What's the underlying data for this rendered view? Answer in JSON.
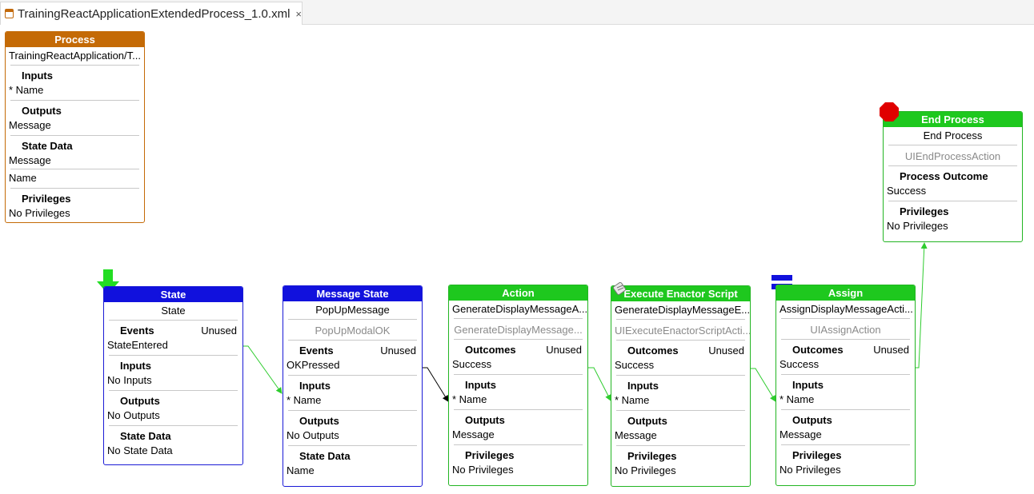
{
  "tab": {
    "title": "TrainingReactApplicationExtendedProcess_1.0.xml",
    "close_glyph": "×",
    "icon": "process-file-icon"
  },
  "colors": {
    "process": "#c46a06",
    "state": "#1111dd",
    "action": "#1ec81e",
    "wire_green": "#2ecc2e",
    "wire_black": "#000000",
    "end_marker": "#e00000"
  },
  "process_node": {
    "header": "Process",
    "name": "TrainingReactApplication/T...",
    "inputs_label": "Inputs",
    "inputs_value": "* Name",
    "outputs_label": "Outputs",
    "outputs_value": "Message",
    "state_data_label": "State Data",
    "state_data_values": [
      "Message",
      "Name"
    ],
    "privileges_label": "Privileges",
    "privileges_value": "No Privileges"
  },
  "state_node": {
    "header": "State",
    "name": "State",
    "events_label": "Events",
    "events_status": "Unused",
    "events_value": "StateEntered",
    "inputs_label": "Inputs",
    "inputs_value": "No Inputs",
    "outputs_label": "Outputs",
    "outputs_value": "No Outputs",
    "state_data_label": "State Data",
    "state_data_value": "No State Data"
  },
  "message_state_node": {
    "header": "Message State",
    "name": "PopUpMessage",
    "subtype": "PopUpModalOK",
    "events_label": "Events",
    "events_status": "Unused",
    "events_value": "OKPressed",
    "inputs_label": "Inputs",
    "inputs_value": "* Name",
    "outputs_label": "Outputs",
    "outputs_value": "No Outputs",
    "state_data_label": "State Data",
    "state_data_value": "Name"
  },
  "action_node": {
    "header": "Action",
    "name": "GenerateDisplayMessageA...",
    "subtype": "GenerateDisplayMessage...",
    "outcomes_label": "Outcomes",
    "outcomes_status": "Unused",
    "outcomes_value": "Success",
    "inputs_label": "Inputs",
    "inputs_value": "* Name",
    "outputs_label": "Outputs",
    "outputs_value": "Message",
    "privileges_label": "Privileges",
    "privileges_value": "No Privileges"
  },
  "script_node": {
    "header": "Execute Enactor Script",
    "name": "GenerateDisplayMessageE...",
    "subtype": "UIExecuteEnactorScriptActi...",
    "outcomes_label": "Outcomes",
    "outcomes_status": "Unused",
    "outcomes_value": "Success",
    "inputs_label": "Inputs",
    "inputs_value": "* Name",
    "outputs_label": "Outputs",
    "outputs_value": "Message",
    "privileges_label": "Privileges",
    "privileges_value": "No Privileges"
  },
  "assign_node": {
    "header": "Assign",
    "name": "AssignDisplayMessageActi...",
    "subtype": "UIAssignAction",
    "outcomes_label": "Outcomes",
    "outcomes_status": "Unused",
    "outcomes_value": "Success",
    "inputs_label": "Inputs",
    "inputs_value": "* Name",
    "outputs_label": "Outputs",
    "outputs_value": "Message",
    "privileges_label": "Privileges",
    "privileges_value": "No Privileges"
  },
  "end_node": {
    "header": "End Process",
    "name": "End Process",
    "subtype": "UIEndProcessAction",
    "outcome_label": "Process Outcome",
    "outcome_value": "Success",
    "privileges_label": "Privileges",
    "privileges_value": "No Privileges"
  }
}
